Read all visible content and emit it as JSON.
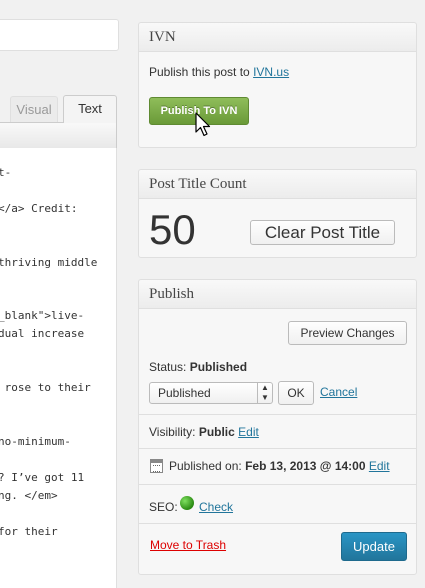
{
  "editor": {
    "tabs": {
      "visual": "Visual",
      "text": "Text"
    },
    "code_lines": [
      "t-",
      "</a> Credit:",
      "thriving middle",
      "_blank\">live-",
      "dual increase",
      " rose to their",
      "no-minimum-",
      "? I’ve got 11",
      "ng. </em>",
      "for their"
    ]
  },
  "ivn_box": {
    "title": "IVN",
    "publish_text": "Publish this post to",
    "publish_link": "IVN.us",
    "button_label": "Publish To IVN"
  },
  "title_count_box": {
    "title": "Post Title Count",
    "count": "50",
    "clear_button": "Clear Post Title"
  },
  "publish_box": {
    "title": "Publish",
    "preview_button": "Preview Changes",
    "status_label": "Status:",
    "status_value": "Published",
    "status_select": "Published",
    "ok_button": "OK",
    "cancel_link": "Cancel",
    "visibility_label": "Visibility:",
    "visibility_value": "Public",
    "visibility_edit": "Edit",
    "published_on_label": "Published on:",
    "published_on_value": "Feb 13, 2013 @ 14:00",
    "published_on_edit": "Edit",
    "seo_label": "SEO:",
    "seo_check": "Check",
    "seo_status_color": "#3aa71e",
    "trash_link": "Move to Trash",
    "update_button": "Update"
  },
  "colors": {
    "link": "#21759b",
    "trash": "#d54e21",
    "publish_green": "#78a745",
    "update_blue": "#2a95c5"
  }
}
